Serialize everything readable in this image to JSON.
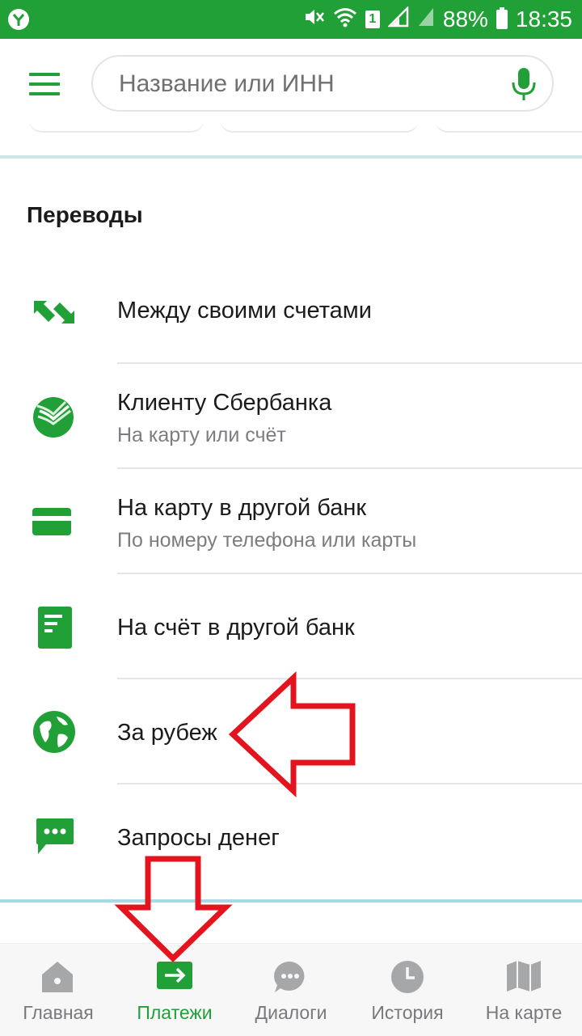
{
  "status_bar": {
    "sim": "1",
    "battery": "88%",
    "time": "18:35"
  },
  "header": {
    "search_placeholder": "Название или ИНН"
  },
  "section": {
    "title": "Переводы",
    "items": [
      {
        "title": "Между своими счетами",
        "subtitle": "",
        "icon": "transfer-arrows-icon"
      },
      {
        "title": "Клиенту Сбербанка",
        "subtitle": "На карту или счёт",
        "icon": "sberbank-logo-icon"
      },
      {
        "title": "На карту в другой банк",
        "subtitle": "По номеру телефона или карты",
        "icon": "card-icon"
      },
      {
        "title": "На счёт в другой банк",
        "subtitle": "",
        "icon": "document-icon"
      },
      {
        "title": "За рубеж",
        "subtitle": "",
        "icon": "globe-icon"
      },
      {
        "title": "Запросы денег",
        "subtitle": "",
        "icon": "chat-bubble-icon"
      }
    ]
  },
  "bottom_nav": {
    "items": [
      {
        "label": "Главная",
        "icon": "home-icon"
      },
      {
        "label": "Платежи",
        "icon": "payments-arrow-icon",
        "active": true
      },
      {
        "label": "Диалоги",
        "icon": "dialogs-icon"
      },
      {
        "label": "История",
        "icon": "clock-icon"
      },
      {
        "label": "На карте",
        "icon": "map-icon"
      }
    ]
  },
  "colors": {
    "brand": "#21a038",
    "annotation_arrow": "#e3141e",
    "muted_text": "#7b7d80",
    "divider": "#cde7e6"
  }
}
